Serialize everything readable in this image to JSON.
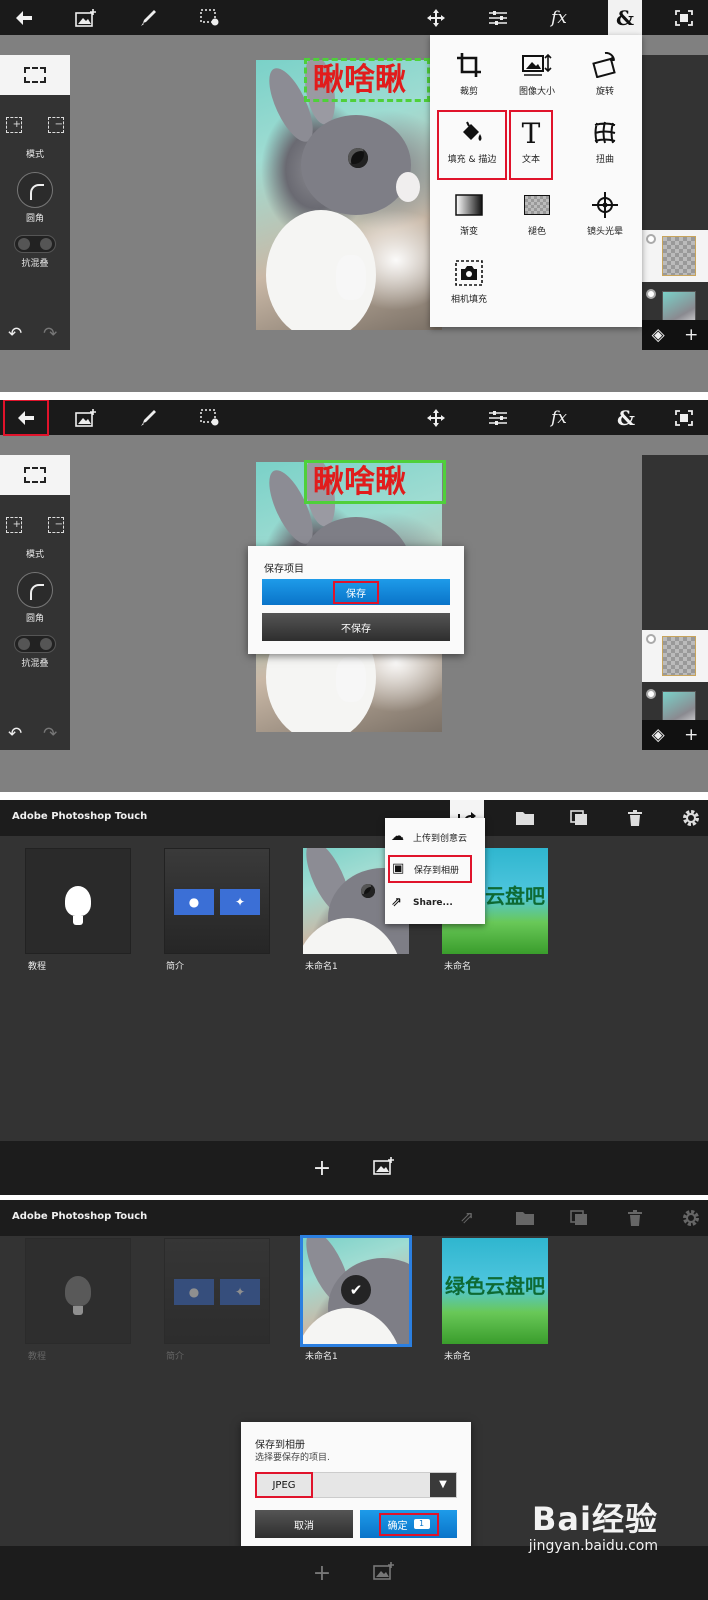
{
  "panel1": {
    "text_layer": "瞅啥瞅",
    "left": {
      "mode_label": "模式",
      "corner_label": "圆角",
      "antialias_label": "抗混叠"
    },
    "menu": [
      {
        "label": "裁剪",
        "icon": "crop-icon"
      },
      {
        "label": "图像大小",
        "icon": "image-size-icon"
      },
      {
        "label": "旋转",
        "icon": "rotate-icon"
      },
      {
        "label": "填充 & 描边",
        "icon": "fill-bucket-icon"
      },
      {
        "label": "文本",
        "icon": "text-icon"
      },
      {
        "label": "扭曲",
        "icon": "warp-icon"
      },
      {
        "label": "渐变",
        "icon": "gradient-icon"
      },
      {
        "label": "褪色",
        "icon": "fade-icon"
      },
      {
        "label": "镜头光晕",
        "icon": "lens-flare-icon"
      },
      {
        "label": "相机填充",
        "icon": "camera-fill-icon"
      }
    ]
  },
  "panel2": {
    "text_layer": "瞅啥瞅",
    "left": {
      "mode_label": "模式",
      "corner_label": "圆角",
      "antialias_label": "抗混叠"
    },
    "dialog": {
      "title": "保存项目",
      "save": "保存",
      "dont_save": "不保存"
    }
  },
  "gallery": {
    "app_title": "Adobe Photoshop Touch",
    "share_menu": {
      "upload": "上传到创意云",
      "save_album": "保存到相册",
      "share": "Share..."
    },
    "cards": [
      {
        "label": "教程"
      },
      {
        "label": "简介"
      },
      {
        "label": "未命名1"
      },
      {
        "label": "未命名",
        "image_text": "绿色云盘吧"
      }
    ]
  },
  "album_dialog": {
    "title": "保存到相册",
    "subtitle": "选择要保存的项目.",
    "format": "JPEG",
    "cancel": "取消",
    "ok": "确定",
    "ok_badge": "1"
  },
  "watermark": {
    "brand": "Bai经验",
    "url": "jingyan.baidu.com"
  },
  "colors": {
    "highlight": "#e0132b",
    "accent_blue": "#0a74c9",
    "toolbar": "#1a1a1a"
  }
}
